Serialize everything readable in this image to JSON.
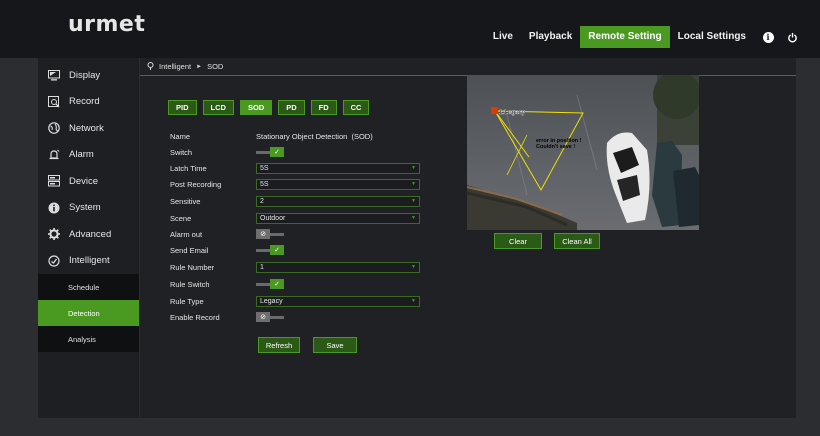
{
  "header": {
    "logo": "urmet",
    "nav": [
      {
        "label": "Live",
        "active": false
      },
      {
        "label": "Playback",
        "active": false
      },
      {
        "label": "Remote Setting",
        "active": true
      },
      {
        "label": "Local Settings",
        "active": false
      }
    ],
    "icons": [
      "info-icon",
      "power-icon"
    ]
  },
  "sidebar": {
    "items": [
      {
        "label": "Display",
        "icon": "monitor-icon"
      },
      {
        "label": "Record",
        "icon": "record-icon"
      },
      {
        "label": "Network",
        "icon": "globe-icon"
      },
      {
        "label": "Alarm",
        "icon": "bell-icon"
      },
      {
        "label": "Device",
        "icon": "hard-drive-icon"
      },
      {
        "label": "System",
        "icon": "info-icon"
      },
      {
        "label": "Advanced",
        "icon": "gear-icon"
      },
      {
        "label": "Intelligent",
        "icon": "intelligent-icon"
      }
    ],
    "subitems": [
      {
        "label": "Schedule",
        "active": false
      },
      {
        "label": "Detection",
        "active": true
      },
      {
        "label": "Analysis",
        "active": false
      }
    ]
  },
  "breadcrumb": {
    "parent": "Intelligent",
    "current": "SOD"
  },
  "tabs": [
    {
      "label": "PID",
      "active": false
    },
    {
      "label": "LCD",
      "active": false
    },
    {
      "label": "SOD",
      "active": true
    },
    {
      "label": "PD",
      "active": false
    },
    {
      "label": "FD",
      "active": false
    },
    {
      "label": "CC",
      "active": false
    }
  ],
  "form": {
    "name_label": "Name",
    "name_value": "Stationary Object Detection  (SOD)",
    "switch_label": "Switch",
    "switch_on": true,
    "latch_time_label": "Latch Time",
    "latch_time_value": "5S",
    "post_recording_label": "Post Recording",
    "post_recording_value": "5S",
    "sensitive_label": "Sensitive",
    "sensitive_value": "2",
    "scene_label": "Scene",
    "scene_value": "Outdoor",
    "alarm_out_label": "Alarm out",
    "alarm_out_on": false,
    "send_email_label": "Send Email",
    "send_email_on": true,
    "rule_number_label": "Rule Number",
    "rule_number_value": "1",
    "rule_switch_label": "Rule Switch",
    "rule_switch_on": true,
    "rule_type_label": "Rule Type",
    "rule_type_value": "Legacy",
    "enable_record_label": "Enable Record",
    "enable_record_on": false
  },
  "actions": {
    "refresh": "Refresh",
    "save": "Save",
    "clear": "Clear",
    "clean_all": "Clean All"
  },
  "preview": {
    "rule_tag": "1:Legacy",
    "error_line1": "error in position !",
    "error_line2": "Couldn't save !"
  },
  "colors": {
    "accent": "#4a9a22",
    "background": "#2b2d31",
    "topbar": "#15171a"
  }
}
